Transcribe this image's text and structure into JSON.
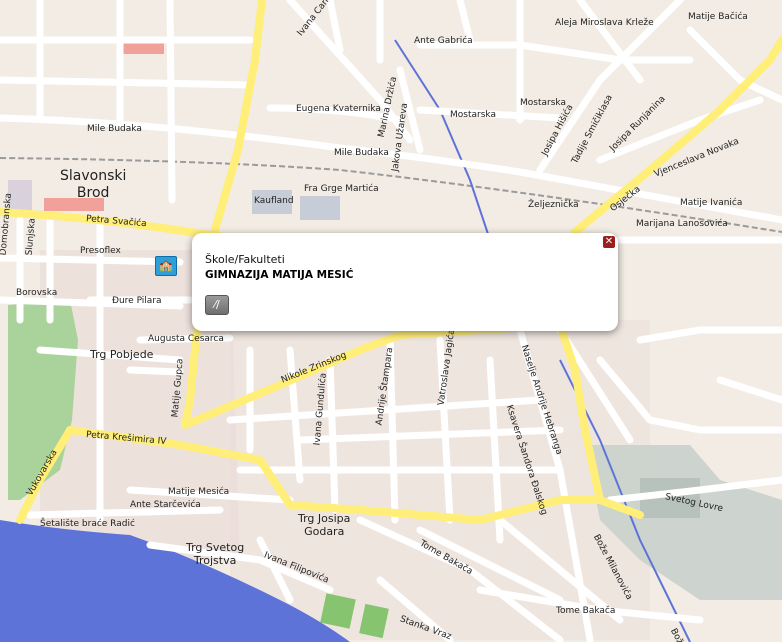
{
  "place": {
    "line1": "Slavonski",
    "line2": "Brod"
  },
  "squares": {
    "trg_pobjede": "Trg Pobjede",
    "trg_josipa_1": "Trg Josipa",
    "trg_josipa_2": "Godara",
    "trg_svetog_1": "Trg Svetog",
    "trg_svetog_2": "Trojstva"
  },
  "streets": {
    "ivana_cankara": "Ivana Cankara",
    "ante_gabrica": "Ante Gabrića",
    "aleja_miroslava_krleze": "Aleja Miroslava Krleže",
    "matije_bacica": "Matije Bačića",
    "mila_budaka_1": "Mile Budaka",
    "mila_budaka_2": "Mile Budaka",
    "eugena_kvaternika": "Eugena Kvaternika",
    "marina_drzica": "Marina Držića",
    "jakova_uzareva": "Jakova Užareva",
    "mostarska_1": "Mostarska",
    "mostarska_2": "Mostarska",
    "josipa_hisica": "Josipa Hišića",
    "tadije_smiciklasa": "Tadije Smičiklasa",
    "josipa_runjanina": "Josipa Runjanina",
    "vjenceslava_novaka": "Vjenceslava Novaka",
    "osjecka": "Osječka",
    "zeljeznicka": "Željeznička",
    "matije_ivanica": "Matije Ivanića",
    "marijana_lanosovica": "Marijana Lanosovića",
    "fra_grge_martica": "Fra Grge Martića",
    "kaufland": "Kaufland",
    "petra_svacica": "Petra Svačića",
    "presoflex": "Presoflex",
    "domobranska": "Domobranska",
    "slunjska": "Slunjska",
    "borovska": "Borovska",
    "djure_pilara": "Đure Pilara",
    "augusta_cesarca": "Augusta Cesarca",
    "matije_gupca": "Matije Gupca",
    "nikole_zrinskog": "Nikole Zrinskog",
    "andrije_stampara": "Andrije Štampara",
    "vatroslava_jagica": "Vatroslava Jagića",
    "ksavera_sandora_djalskog": "Ksavera Šandora Đalskog",
    "naselje_andrije_hebranga": "Naselje Andrije Hebranga",
    "petra_kresimira_iv": "Petra Krešimira IV",
    "vukovarska": "Vukovarska",
    "ivana_gundulica": "Ivana Gundulića",
    "matije_mesica": "Matije Mesića",
    "ante_starcevica": "Ante Starčevića",
    "setaliste_brace_radic": "Šetalište braće Radić",
    "ivana_filipovica": "Ivana Filipovića",
    "tome_bakaca_1": "Tome Bakača",
    "tome_bakaca_2": "Tome Bakača",
    "stanka_vraza": "Stanka Vraz",
    "svetog_lovre": "Svetog Lovre",
    "bozo_milanovica": "Bože Milanovića",
    "bozo_milanovica_2": "Bože M"
  },
  "popup": {
    "category": "Škole/Fakulteti",
    "name": "GIMNAZIJA MATIJA MESIĆ",
    "close_symbol": "✕",
    "tool_symbol": "⁄∕"
  },
  "colors": {
    "background": "#f2ece4",
    "major_road": "#ffee77",
    "minor_road": "#ffffff",
    "park": "#a9d39a",
    "river": "#5e73d8",
    "railway": "#9a9a9a"
  }
}
